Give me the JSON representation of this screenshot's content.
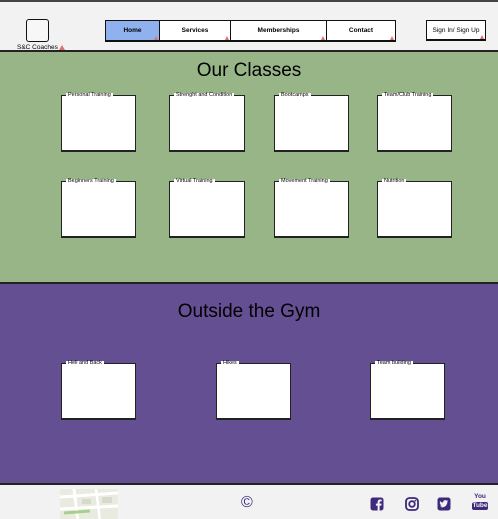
{
  "header": {
    "logo_label": "S&C Coaches",
    "nav": [
      {
        "label": "Home",
        "active": true
      },
      {
        "label": "Services",
        "active": false
      },
      {
        "label": "Memberships",
        "active": false
      },
      {
        "label": "Contact",
        "active": false
      }
    ],
    "signin_label": "Sign In/ Sign Up"
  },
  "classes": {
    "title": "Our Classes",
    "cards": [
      "Personal Training",
      "Strenght and Condition",
      "Bootcamps",
      "Team/Club Training",
      "Beginners Training",
      "Virtual Training",
      "Movement Training",
      "Nutrition"
    ]
  },
  "outside": {
    "title": "Outside the Gym",
    "cards": [
      "Hell and Back",
      "Hikes",
      "Team building"
    ]
  },
  "footer": {
    "copyright": "©",
    "social": [
      {
        "icon": "facebook-icon"
      },
      {
        "icon": "instagram-icon"
      },
      {
        "icon": "twitter-icon"
      },
      {
        "icon": "youtube-icon",
        "text_top": "You",
        "text_bottom": "Tube"
      }
    ]
  },
  "colors": {
    "classes_bg": "#97b587",
    "outside_bg": "#634f92",
    "nav_active": "#8fb2ef",
    "social": "#3d2a7a"
  }
}
